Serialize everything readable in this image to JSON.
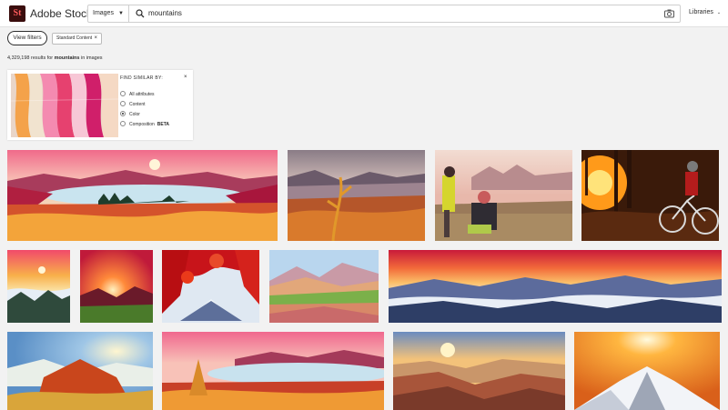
{
  "header": {
    "logo_text": "St",
    "brand": "Adobe Stock",
    "search_type": "Images",
    "search_value": "mountains",
    "libraries": "Libraries"
  },
  "filters": {
    "view_filters_label": "View filters",
    "chip_label": "Standard Content"
  },
  "results": {
    "count": "4,329,198",
    "text_mid": " results for ",
    "query": "mountains",
    "text_end": " in images"
  },
  "find_similar": {
    "title": "FIND SIMILAR BY:",
    "options": [
      {
        "label": "All attributes",
        "selected": false
      },
      {
        "label": "Content",
        "selected": false
      },
      {
        "label": "Color",
        "selected": true
      },
      {
        "label": "Composition",
        "selected": false,
        "badge": "BETA"
      }
    ]
  },
  "images": [
    {
      "name": "red-lake-panorama"
    },
    {
      "name": "autumn-valley"
    },
    {
      "name": "hikers-on-summit"
    },
    {
      "name": "mountain-biker-sunset"
    },
    {
      "name": "sunrise-above-clouds"
    },
    {
      "name": "sunset-valley-red"
    },
    {
      "name": "fuji-red-leaves"
    },
    {
      "name": "rainbow-hills"
    },
    {
      "name": "misty-mountain-panorama"
    },
    {
      "name": "sun-over-foggy-hills"
    },
    {
      "name": "lake-with-pink-sky"
    },
    {
      "name": "grand-canyon-sunrise"
    },
    {
      "name": "snowy-peak-sunset"
    }
  ]
}
